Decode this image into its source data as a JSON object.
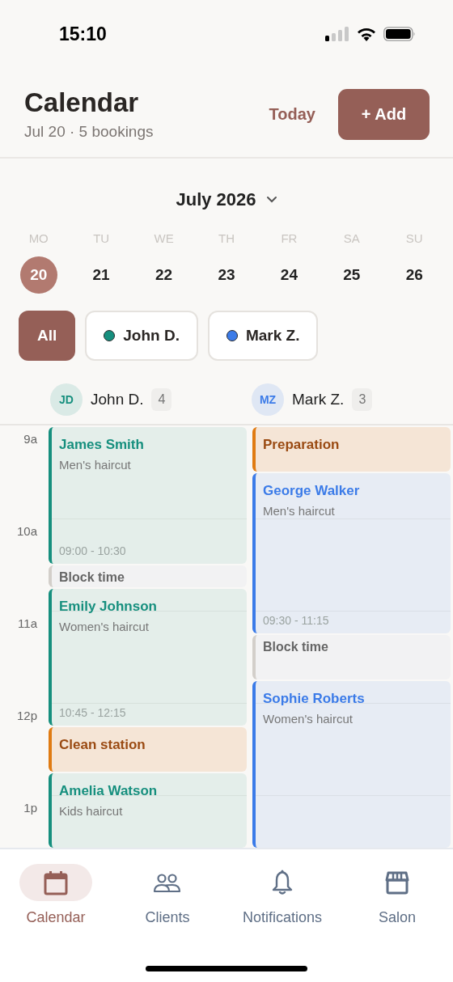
{
  "status_bar": {
    "time": "15:10"
  },
  "header": {
    "title": "Calendar",
    "subtitle": "Jul 20 · 5 bookings",
    "today_button": "Today",
    "add_button": "+ Add"
  },
  "month_picker": {
    "label": "July 2026"
  },
  "week": [
    {
      "weekday": "MO",
      "date": "20",
      "selected": true
    },
    {
      "weekday": "TU",
      "date": "21",
      "selected": false
    },
    {
      "weekday": "WE",
      "date": "22",
      "selected": false
    },
    {
      "weekday": "TH",
      "date": "23",
      "selected": false
    },
    {
      "weekday": "FR",
      "date": "24",
      "selected": false
    },
    {
      "weekday": "SA",
      "date": "25",
      "selected": false
    },
    {
      "weekday": "SU",
      "date": "26",
      "selected": false
    }
  ],
  "staff_filter": [
    {
      "label": "All",
      "selected": true
    },
    {
      "label": "John D.",
      "color": "#168f7e",
      "selected": false
    },
    {
      "label": "Mark Z.",
      "color": "#3b7be8",
      "selected": false
    }
  ],
  "hours": [
    "9a",
    "10a",
    "11a",
    "12p",
    "1p"
  ],
  "staff": [
    {
      "initials": "JD",
      "name": "John D.",
      "count": "4",
      "color": "#168f7e",
      "events": [
        {
          "kind": "booking",
          "client": "James Smith",
          "service": "Men's haircut",
          "time": "09:00 - 10:30"
        },
        {
          "kind": "block",
          "title": "Block time"
        },
        {
          "kind": "booking",
          "client": "Emily Johnson",
          "service": "Women's haircut",
          "time": "10:45 - 12:15"
        },
        {
          "kind": "task",
          "title": "Clean station"
        },
        {
          "kind": "booking",
          "client": "Amelia Watson",
          "service": "Kids haircut"
        }
      ]
    },
    {
      "initials": "MZ",
      "name": "Mark Z.",
      "count": "3",
      "color": "#3b7be8",
      "events": [
        {
          "kind": "task",
          "title": "Preparation"
        },
        {
          "kind": "booking",
          "client": "George Walker",
          "service": "Men's haircut",
          "time": "09:30 - 11:15"
        },
        {
          "kind": "block",
          "title": "Block time"
        },
        {
          "kind": "booking",
          "client": "Sophie Roberts",
          "service": "Women's haircut"
        }
      ]
    }
  ],
  "tabs": [
    {
      "label": "Calendar",
      "selected": true
    },
    {
      "label": "Clients",
      "selected": false
    },
    {
      "label": "Notifications",
      "selected": false
    },
    {
      "label": "Salon",
      "selected": false
    }
  ]
}
